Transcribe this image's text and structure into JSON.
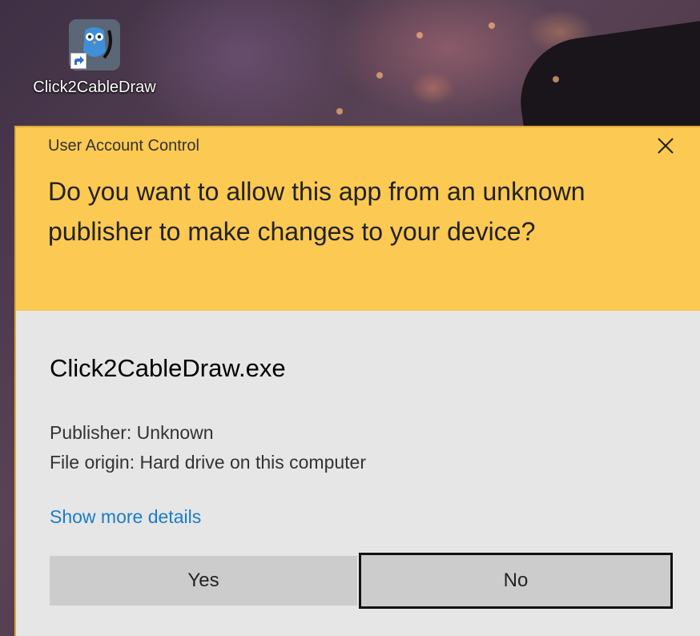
{
  "desktop": {
    "shortcut_label": "Click2CableDraw"
  },
  "dialog": {
    "title": "User Account Control",
    "question": "Do you want to allow this app from an unknown publisher to make changes to your device?",
    "app_name": "Click2CableDraw.exe",
    "publisher": "Publisher: Unknown",
    "file_origin": "File origin: Hard drive on this computer",
    "details_link": "Show more details",
    "yes_label": "Yes",
    "no_label": "No",
    "header_color": "#fcc953",
    "body_color": "#e6e6e6",
    "link_color": "#1a7cc8"
  },
  "icons": {
    "close": "close-icon",
    "app": "owl-app-icon",
    "shortcut": "shortcut-arrow-icon"
  }
}
